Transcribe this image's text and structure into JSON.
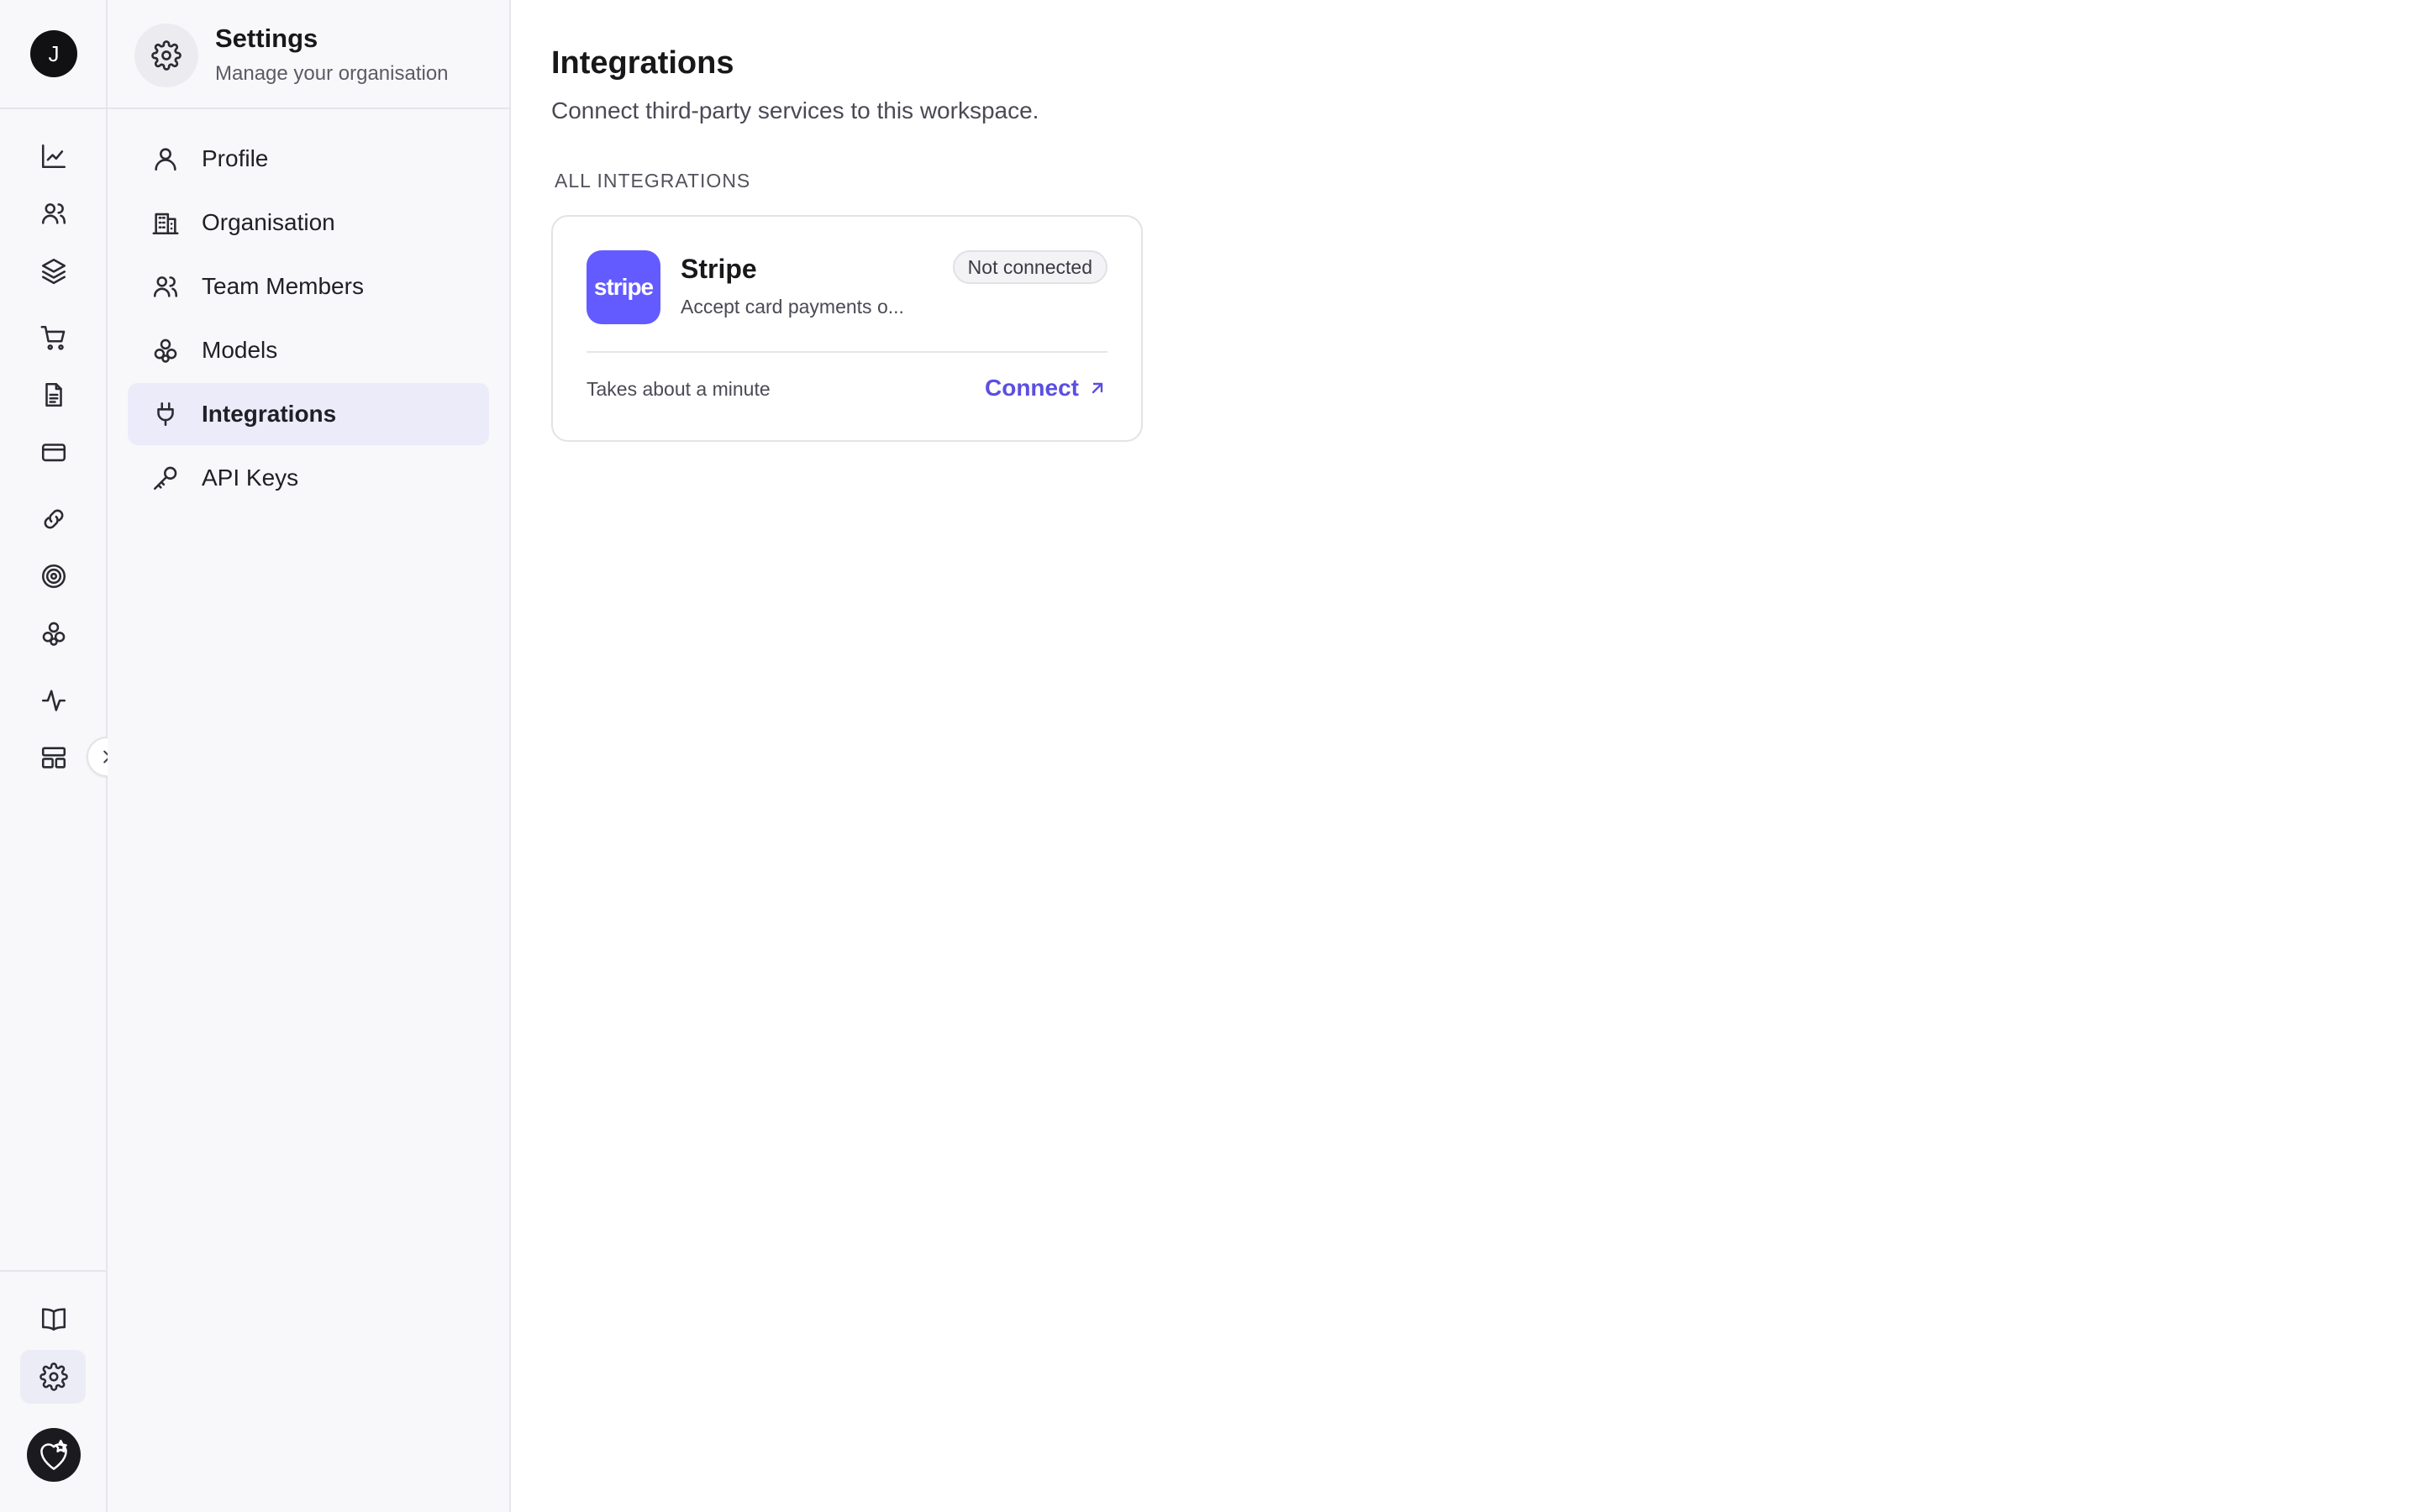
{
  "rail": {
    "workspace_initial": "J",
    "icons": [
      "analytics-icon",
      "users-icon",
      "layers-icon",
      "cart-icon",
      "document-icon",
      "credit-card-icon",
      "link-icon",
      "target-icon",
      "models-icon",
      "activity-icon",
      "layout-icon"
    ],
    "bottom_icons": [
      "book-icon",
      "gear-icon"
    ],
    "active_icon": "gear-icon"
  },
  "sidebar": {
    "title": "Settings",
    "subtitle": "Manage your organisation",
    "items": [
      {
        "label": "Profile",
        "icon": "user-icon"
      },
      {
        "label": "Organisation",
        "icon": "building-icon"
      },
      {
        "label": "Team Members",
        "icon": "users-icon"
      },
      {
        "label": "Models",
        "icon": "models-icon"
      },
      {
        "label": "Integrations",
        "icon": "plug-icon",
        "active": true
      },
      {
        "label": "API Keys",
        "icon": "key-icon"
      }
    ]
  },
  "main": {
    "title": "Integrations",
    "subtitle": "Connect third-party services to this workspace.",
    "section_label": "ALL INTEGRATIONS",
    "integrations": [
      {
        "name": "Stripe",
        "logo_text": "stripe",
        "description": "Accept card payments o...",
        "status": "Not connected",
        "footer_text": "Takes about a minute",
        "action_label": "Connect"
      }
    ]
  },
  "colors": {
    "accent": "#5b4fe0",
    "stripe_brand": "#635bff",
    "active_bg": "#ecebfa",
    "sidebar_bg": "#f8f8fa"
  }
}
